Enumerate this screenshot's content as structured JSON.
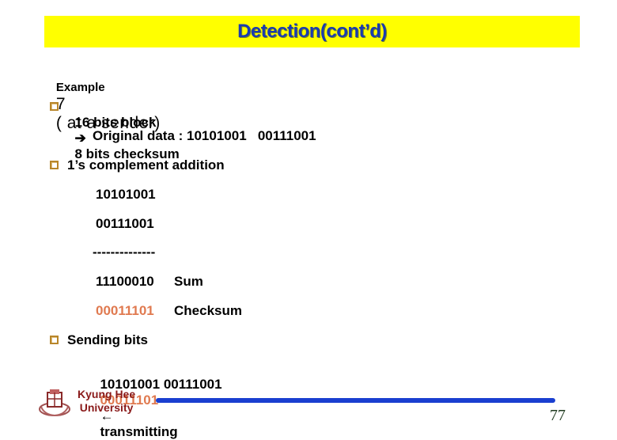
{
  "slide": {
    "title": "Detection(cont’d)",
    "example_label": "Example",
    "example_number": "7",
    "example_rest": "( at a sender)",
    "bullets": [
      {
        "text_before": "16 bits block",
        "arrow": "➔",
        "text_after": "8 bits checksum"
      },
      {
        "text": "1’s complement addition"
      },
      {
        "text": "Sending bits"
      }
    ],
    "original_data": "Original data : 10101001   00111001",
    "addition": {
      "operand1": "10101001",
      "operand2": "00111001",
      "separator": "--------------",
      "sum_value": "11100010",
      "sum_label": "Sum",
      "checksum_value": "00011101",
      "checksum_label": "Checksum"
    },
    "sending": {
      "data_bits": "10101001 00111001",
      "checksum_bits": "00011101",
      "arrow": "🡐",
      "label": "transmitting"
    },
    "footer": {
      "university_line1": "Kyung Hee",
      "university_line2": "University",
      "page_number": "77"
    },
    "colors": {
      "title_bg": "#ffff00",
      "title_text": "#1a3bb0",
      "checksum": "#e07a50",
      "footer_bar": "#1a3fd0",
      "university": "#8a1a1a"
    }
  }
}
